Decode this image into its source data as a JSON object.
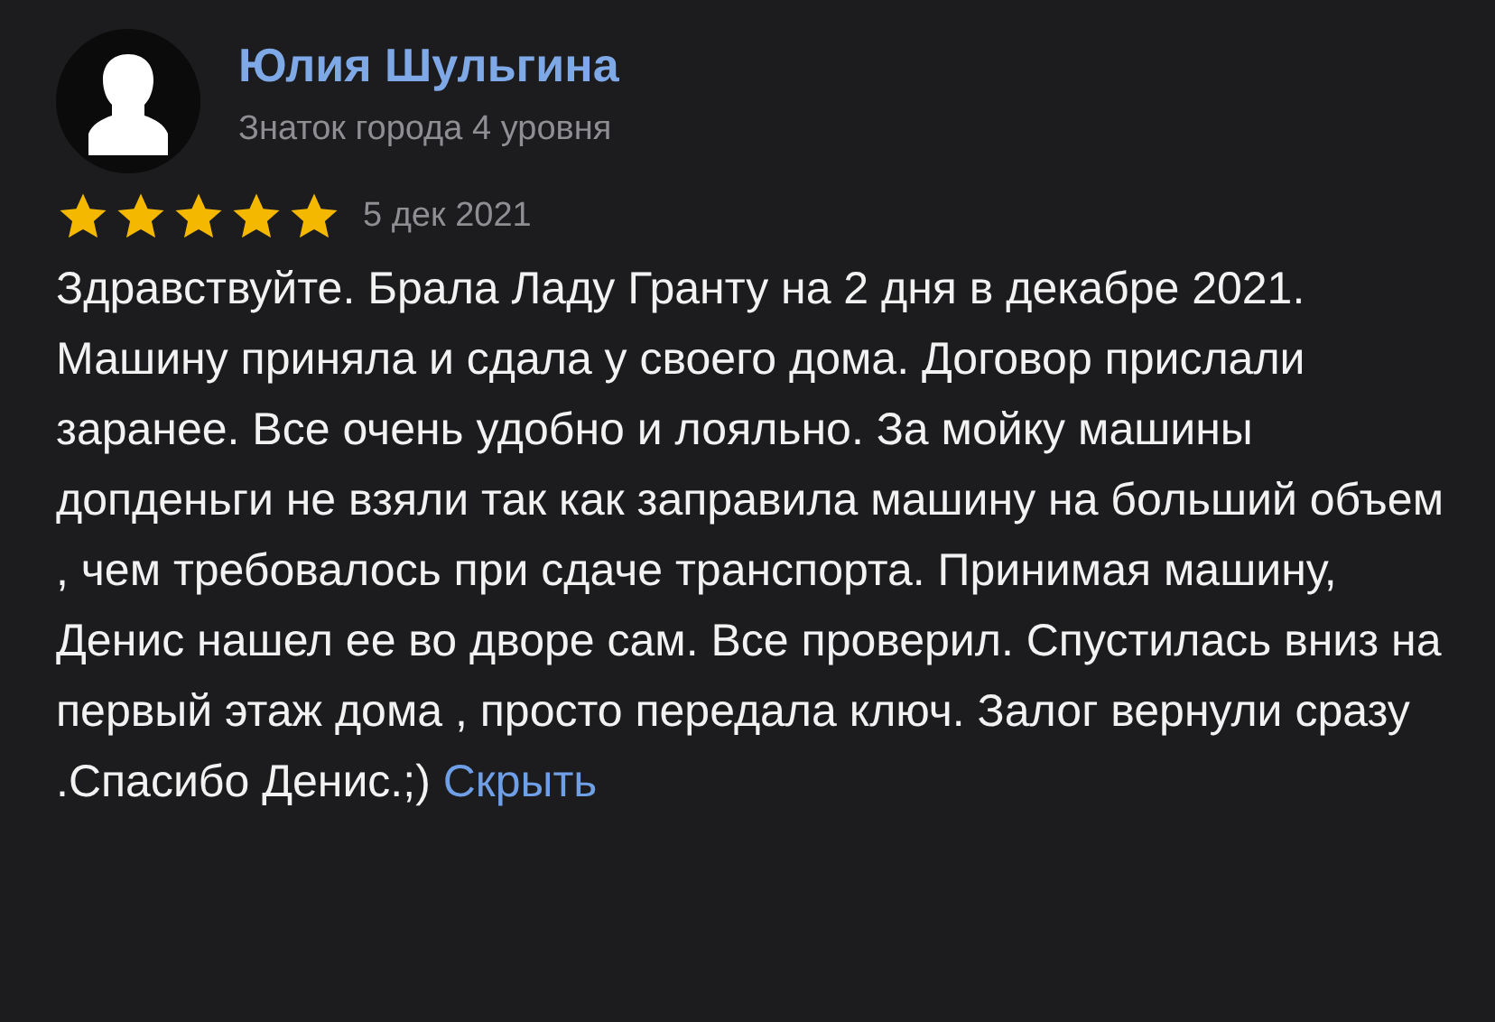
{
  "author": {
    "name": "Юлия Шульгина",
    "level": "Знаток города 4 уровня"
  },
  "review": {
    "stars": 5,
    "date": "5 дек 2021",
    "text": "Здравствуйте. Брала Ладу Гранту на 2 дня в декабре 2021. Машину приняла и сдала у своего дома. Договор прислали заранее. Все очень удобно и лояльно. За мойку машины допденьги не взяли так как заправила машину на больший объем , чем требовалось при сдаче транспорта. Принимая машину, Денис нашел ее во дворе сам. Все проверил. Спустилась вниз на первый этаж дома , просто передала ключ. Залог вернули сразу .Спасибо Денис.;)",
    "hide_link": "Скрыть"
  }
}
